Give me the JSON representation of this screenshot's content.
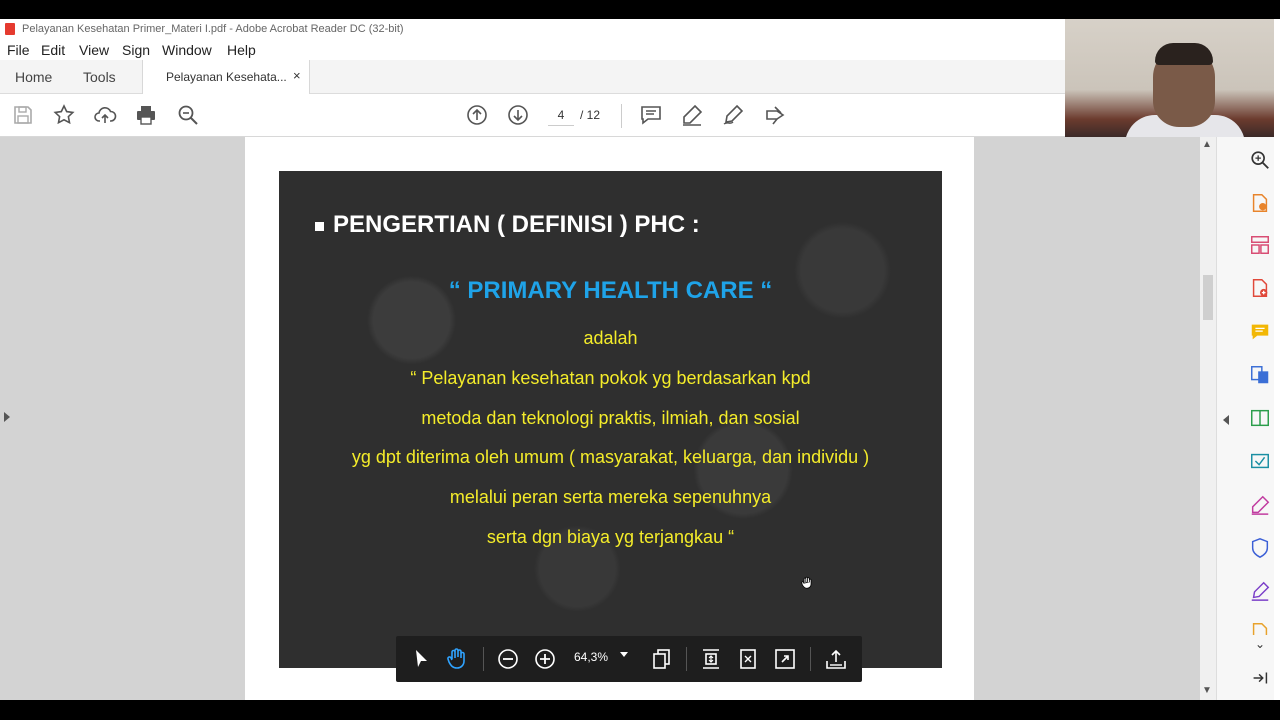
{
  "window": {
    "title": "Pelayanan Kesehatan Primer_Materi I.pdf - Adobe Acrobat Reader DC (32-bit)"
  },
  "menu": [
    "File",
    "Edit",
    "View",
    "Sign",
    "Window",
    "Help"
  ],
  "tabs": {
    "home": "Home",
    "tools": "Tools",
    "document": "Pelayanan Kesehata...",
    "close": "×"
  },
  "toolbar": {
    "page_current": "4",
    "page_total": "/ 12"
  },
  "slide": {
    "heading": "PENGERTIAN  ( DEFINISI )  PHC  :",
    "term": "“ PRIMARY  HEALTH  CARE “",
    "lines": [
      "adalah",
      "“ Pelayanan  kesehatan  pokok  yg  berdasarkan  kpd",
      "metoda  dan teknologi  praktis,  ilmiah,  dan  sosial",
      "yg  dpt  diterima  oleh  umum   ( masyarakat, keluarga, dan individu )",
      "melalui  peran serta  mereka  sepenuhnya",
      "serta  dgn  biaya  yg  terjangkau “"
    ],
    "colors": {
      "heading": "#ffffff",
      "term": "#1fa3e8",
      "body": "#f4ec2a",
      "background": "#2f2f2f"
    }
  },
  "floating_toolbar": {
    "zoom": "64,3%"
  }
}
